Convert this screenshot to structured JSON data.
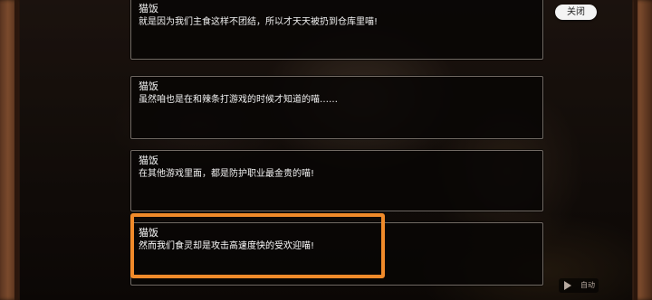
{
  "close_label": "关闭",
  "auto_label": "自动",
  "dialogue": [
    {
      "speaker": "猫饭",
      "text": "就是因为我们主食这样不团结，所以才天天被扔到仓库里喵!"
    },
    {
      "speaker": "猫饭",
      "text": "虽然咱也是在和辣条打游戏的时候才知道的喵……"
    },
    {
      "speaker": "猫饭",
      "text": "在其他游戏里面，都是防护职业最金贵的喵!"
    },
    {
      "speaker": "猫饭",
      "text": "然而我们食灵却是攻击高速度快的受欢迎喵!"
    }
  ],
  "colors": {
    "highlight": "#f08a2a"
  }
}
